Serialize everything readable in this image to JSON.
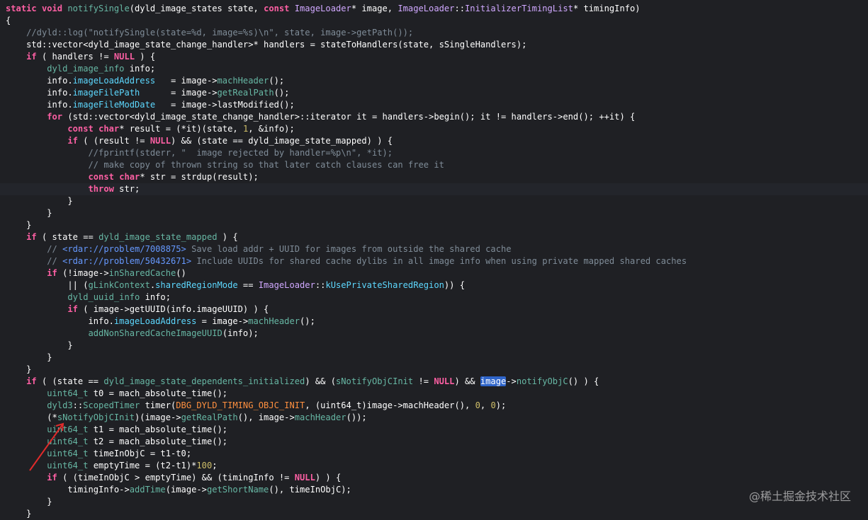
{
  "editor": {
    "language": "C++",
    "lines": [
      [
        [
          "kw",
          "static "
        ],
        [
          "kw",
          "void "
        ],
        [
          "fn",
          "notifySingle"
        ],
        [
          "plain",
          "(dyld_image_states state, "
        ],
        [
          "kw",
          "const "
        ],
        [
          "type",
          "ImageLoader"
        ],
        [
          "plain",
          "* image, "
        ],
        [
          "type",
          "ImageLoader"
        ],
        [
          "plain",
          "::"
        ],
        [
          "type",
          "InitializerTimingList"
        ],
        [
          "plain",
          "* timingInfo)"
        ]
      ],
      [
        [
          "plain",
          "{"
        ]
      ],
      [
        [
          "plain",
          "    "
        ],
        [
          "comment",
          "//dyld::log(\"notifySingle(state=%d, image=%s)\\n\", state, image->getPath());"
        ]
      ],
      [
        [
          "plain",
          "    std::vector<dyld_image_state_change_handler>* handlers = stateToHandlers(state, sSingleHandlers);"
        ]
      ],
      [
        [
          "plain",
          "    "
        ],
        [
          "kw",
          "if"
        ],
        [
          "plain",
          " ( handlers != "
        ],
        [
          "kw",
          "NULL"
        ],
        [
          "plain",
          " ) {"
        ]
      ],
      [
        [
          "plain",
          "        "
        ],
        [
          "ident",
          "dyld_image_info"
        ],
        [
          "plain",
          " info;"
        ]
      ],
      [
        [
          "plain",
          "        info."
        ],
        [
          "mem",
          "imageLoadAddress"
        ],
        [
          "plain",
          "   = image->"
        ],
        [
          "fn",
          "machHeader"
        ],
        [
          "plain",
          "();"
        ]
      ],
      [
        [
          "plain",
          "        info."
        ],
        [
          "mem",
          "imageFilePath"
        ],
        [
          "plain",
          "      = image->"
        ],
        [
          "fn",
          "getRealPath"
        ],
        [
          "plain",
          "();"
        ]
      ],
      [
        [
          "plain",
          "        info."
        ],
        [
          "mem",
          "imageFileModDate"
        ],
        [
          "plain",
          "   = image->lastModified();"
        ]
      ],
      [
        [
          "plain",
          "        "
        ],
        [
          "kw",
          "for"
        ],
        [
          "plain",
          " (std::vector<dyld_image_state_change_handler>::iterator it = handlers->begin(); it != handlers->end(); ++it) {"
        ]
      ],
      [
        [
          "plain",
          "            "
        ],
        [
          "kw",
          "const "
        ],
        [
          "kw",
          "char"
        ],
        [
          "plain",
          "* result = (*it)(state, "
        ],
        [
          "num",
          "1"
        ],
        [
          "plain",
          ", &info);"
        ]
      ],
      [
        [
          "plain",
          "            "
        ],
        [
          "kw",
          "if"
        ],
        [
          "plain",
          " ( (result != "
        ],
        [
          "kw",
          "NULL"
        ],
        [
          "plain",
          ") && (state == dyld_image_state_mapped) ) {"
        ]
      ],
      [
        [
          "plain",
          "                "
        ],
        [
          "comment",
          "//fprintf(stderr, \"  image rejected by handler=%p\\n\", *it);"
        ]
      ],
      [
        [
          "plain",
          "                "
        ],
        [
          "comment",
          "// make copy of thrown string so that later catch clauses can free it"
        ]
      ],
      [
        [
          "plain",
          "                "
        ],
        [
          "kw",
          "const "
        ],
        [
          "kw",
          "char"
        ],
        [
          "plain",
          "* str = strdup(result);"
        ]
      ],
      [
        [
          "plain",
          "                "
        ],
        [
          "kw",
          "throw"
        ],
        [
          "plain",
          " str;"
        ]
      ],
      [
        [
          "plain",
          "            }"
        ]
      ],
      [
        [
          "plain",
          "        }"
        ]
      ],
      [
        [
          "plain",
          "    }"
        ]
      ],
      [
        [
          "plain",
          "    "
        ],
        [
          "kw",
          "if"
        ],
        [
          "plain",
          " ( state == "
        ],
        [
          "ident",
          "dyld_image_state_mapped"
        ],
        [
          "plain",
          " ) {"
        ]
      ],
      [
        [
          "plain",
          "        "
        ],
        [
          "comment",
          "// "
        ],
        [
          "link",
          "<rdar://problem/7008875>"
        ],
        [
          "comment",
          " Save load addr + UUID for images from outside the shared cache"
        ]
      ],
      [
        [
          "plain",
          "        "
        ],
        [
          "comment",
          "// "
        ],
        [
          "link",
          "<rdar://problem/50432671>"
        ],
        [
          "comment",
          " Include UUIDs for shared cache dylibs in all image info when using private mapped shared caches"
        ]
      ],
      [
        [
          "plain",
          "        "
        ],
        [
          "kw",
          "if"
        ],
        [
          "plain",
          " (!image->"
        ],
        [
          "fn",
          "inSharedCache"
        ],
        [
          "plain",
          "()"
        ]
      ],
      [
        [
          "plain",
          "            || ("
        ],
        [
          "ident",
          "gLinkContext"
        ],
        [
          "plain",
          "."
        ],
        [
          "mem",
          "sharedRegionMode"
        ],
        [
          "plain",
          " == "
        ],
        [
          "type",
          "ImageLoader"
        ],
        [
          "plain",
          "::"
        ],
        [
          "mem",
          "kUsePrivateSharedRegion"
        ],
        [
          "plain",
          ")) {"
        ]
      ],
      [
        [
          "plain",
          "            "
        ],
        [
          "ident",
          "dyld_uuid_info"
        ],
        [
          "plain",
          " info;"
        ]
      ],
      [
        [
          "plain",
          "            "
        ],
        [
          "kw",
          "if"
        ],
        [
          "plain",
          " ( image->getUUID(info.imageUUID) ) {"
        ]
      ],
      [
        [
          "plain",
          "                info."
        ],
        [
          "mem",
          "imageLoadAddress"
        ],
        [
          "plain",
          " = image->"
        ],
        [
          "fn",
          "machHeader"
        ],
        [
          "plain",
          "();"
        ]
      ],
      [
        [
          "plain",
          "                "
        ],
        [
          "fn",
          "addNonSharedCacheImageUUID"
        ],
        [
          "plain",
          "(info);"
        ]
      ],
      [
        [
          "plain",
          "            }"
        ]
      ],
      [
        [
          "plain",
          "        }"
        ]
      ],
      [
        [
          "plain",
          "    }"
        ]
      ],
      [
        [
          "plain",
          "    "
        ],
        [
          "kw",
          "if"
        ],
        [
          "plain",
          " ( (state == "
        ],
        [
          "ident",
          "dyld_image_state_dependents_initialized"
        ],
        [
          "plain",
          ") && ("
        ],
        [
          "ident",
          "sNotifyObjCInit"
        ],
        [
          "plain",
          " != "
        ],
        [
          "kw",
          "NULL"
        ],
        [
          "plain",
          ") && "
        ],
        [
          "sel",
          "image"
        ],
        [
          "plain",
          "->"
        ],
        [
          "fn",
          "notifyObjC"
        ],
        [
          "plain",
          "() ) {"
        ]
      ],
      [
        [
          "plain",
          "        "
        ],
        [
          "ident",
          "uint64_t"
        ],
        [
          "plain",
          " t0 = mach_absolute_time();"
        ]
      ],
      [
        [
          "plain",
          "        "
        ],
        [
          "ident",
          "dyld3"
        ],
        [
          "plain",
          "::"
        ],
        [
          "ident",
          "ScopedTimer"
        ],
        [
          "plain",
          " timer("
        ],
        [
          "macro",
          "DBG_DYLD_TIMING_OBJC_INIT"
        ],
        [
          "plain",
          ", (uint64_t)image->machHeader(), "
        ],
        [
          "num",
          "0"
        ],
        [
          "plain",
          ", "
        ],
        [
          "num",
          "0"
        ],
        [
          "plain",
          ");"
        ]
      ],
      [
        [
          "plain",
          "        (*"
        ],
        [
          "ident",
          "sNotifyObjCInit"
        ],
        [
          "plain",
          ")(image->"
        ],
        [
          "fn",
          "getRealPath"
        ],
        [
          "plain",
          "(), image->"
        ],
        [
          "fn",
          "machHeader"
        ],
        [
          "plain",
          "());"
        ]
      ],
      [
        [
          "plain",
          "        "
        ],
        [
          "ident",
          "uint64_t"
        ],
        [
          "plain",
          " t1 = mach_absolute_time();"
        ]
      ],
      [
        [
          "plain",
          "        "
        ],
        [
          "ident",
          "uint64_t"
        ],
        [
          "plain",
          " t2 = mach_absolute_time();"
        ]
      ],
      [
        [
          "plain",
          "        "
        ],
        [
          "ident",
          "uint64_t"
        ],
        [
          "plain",
          " timeInObjC = t1-t0;"
        ]
      ],
      [
        [
          "plain",
          "        "
        ],
        [
          "ident",
          "uint64_t"
        ],
        [
          "plain",
          " emptyTime = (t2-t1)*"
        ],
        [
          "num",
          "100"
        ],
        [
          "plain",
          ";"
        ]
      ],
      [
        [
          "plain",
          "        "
        ],
        [
          "kw",
          "if"
        ],
        [
          "plain",
          " ( (timeInObjC > emptyTime) && (timingInfo != "
        ],
        [
          "kw",
          "NULL"
        ],
        [
          "plain",
          ") ) {"
        ]
      ],
      [
        [
          "plain",
          "            timingInfo->"
        ],
        [
          "fn",
          "addTime"
        ],
        [
          "plain",
          "(image->"
        ],
        [
          "fn",
          "getShortName"
        ],
        [
          "plain",
          "(), timeInObjC);"
        ]
      ],
      [
        [
          "plain",
          "        }"
        ]
      ],
      [
        [
          "plain",
          "    }"
        ]
      ]
    ],
    "current_line_index": 15
  },
  "watermark": {
    "text": "@稀土掘金技术社区"
  },
  "annotation": {
    "icon": "red-arrow-icon",
    "color": "#e02b2b"
  },
  "colors": {
    "background": "#1f2024",
    "keyword": "#fc5fa3",
    "function": "#67b7a4",
    "type": "#d0a8ff",
    "member": "#5dd8ff",
    "comment": "#7f8c98",
    "number": "#d0bf69",
    "macro": "#fd8f3f",
    "selection": "#2f65ca"
  }
}
